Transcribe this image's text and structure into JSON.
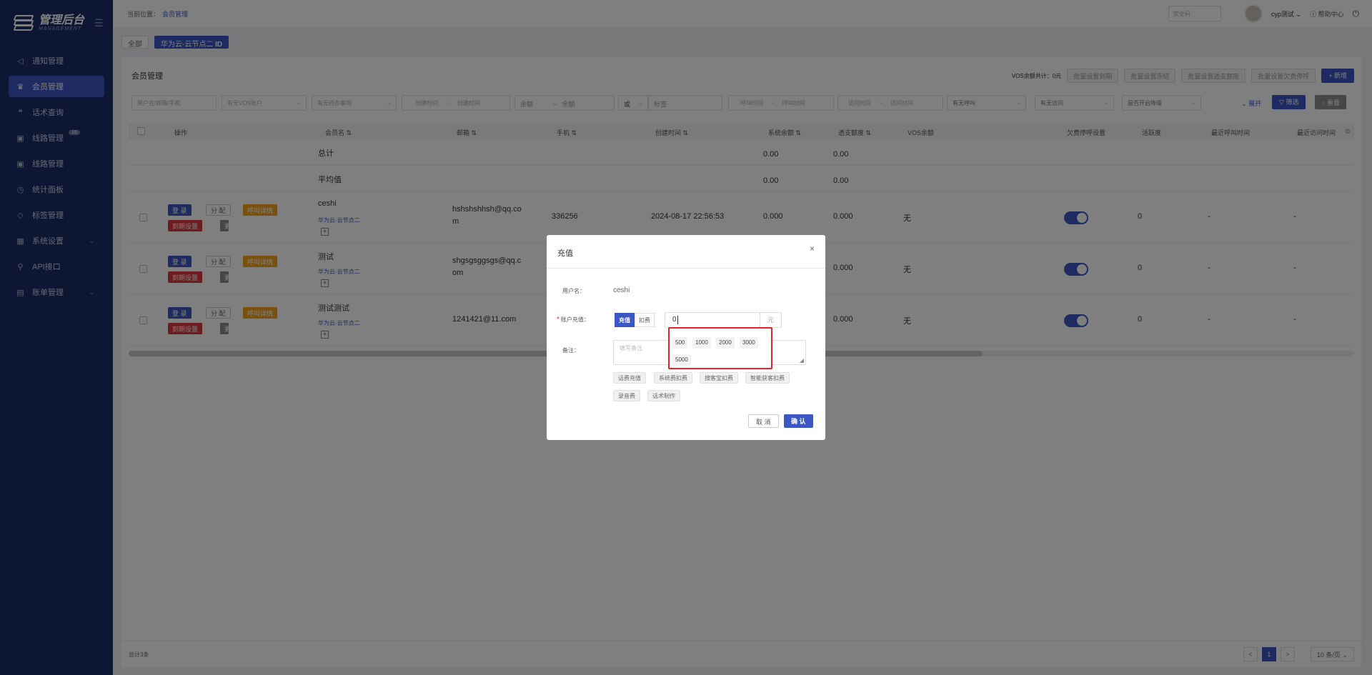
{
  "brand": {
    "title": "管理后台",
    "subtitle": "MANAGEMENT"
  },
  "sidebar": {
    "items": [
      {
        "label": "通知管理"
      },
      {
        "label": "会员管理"
      },
      {
        "label": "话术查询"
      },
      {
        "label": "线路管理",
        "badge": "10"
      },
      {
        "label": "线路管理"
      },
      {
        "label": "统计面板"
      },
      {
        "label": "标签管理"
      },
      {
        "label": "系统设置"
      },
      {
        "label": "API接口"
      },
      {
        "label": "账单管理"
      }
    ]
  },
  "topbar": {
    "crumb_prefix": "当前位置：",
    "crumb_link": "会员管理",
    "search_placeholder": "安全码",
    "user": "cyp测试",
    "help": "帮助中心"
  },
  "tags": {
    "all": "全部",
    "active": "华为云-云节点二",
    "active_suffix": "ID"
  },
  "panel": {
    "title": "会员管理",
    "vos_total": "VOS余额共计：0元",
    "batch_buttons": [
      "批量设置到期",
      "批量设置冻结",
      "批量设置透支额度",
      "批量设置欠费停呼"
    ],
    "add_label": "+ 新增",
    "expand_label": "展开",
    "filter_label": "筛选",
    "reset_label": "重置"
  },
  "filters": {
    "user": "用户名/邮箱/手机",
    "vos": "有无VOS账户",
    "todo": "有无待办事项",
    "create_start": "创建时间",
    "create_end": "创建时间",
    "bal_min": "余额",
    "bal_max": "余额",
    "or": "或",
    "tag": "标签",
    "call_start": "呼叫时间",
    "call_end": "呼叫时间",
    "visit_start": "访问时间",
    "visit_end": "访问时间",
    "has_call": "有无呼叫",
    "has_visit": "有无访问",
    "stop": "是否开启降噪",
    "sep": "~"
  },
  "table": {
    "headers": {
      "op": "操作",
      "name": "会员名 ⇅",
      "email": "邮箱 ⇅",
      "phone": "手机 ⇅",
      "created": "创建时间 ⇅",
      "balance": "系统余额 ⇅",
      "overdraft": "透支额度 ⇅",
      "vos": "VOS余额",
      "stop": "欠费停呼设置",
      "activity": "活跃度",
      "last_call": "最近呼叫时间",
      "last_visit": "最近访问时间"
    },
    "summary": [
      {
        "label": "总计",
        "balance": "0.00",
        "overdraft": "0.00"
      },
      {
        "label": "平均值",
        "balance": "0.00",
        "overdraft": "0.00"
      }
    ],
    "row_buttons": {
      "login": "登 录",
      "assign": "分 配",
      "call": "呼叫详情",
      "expire": "到期设置",
      "more": "更 多"
    },
    "rows": [
      {
        "name": "ceshi",
        "sub": "华为云-云节点二",
        "email_line1": "hshshshhsh@qq.co",
        "email_line2": "m",
        "phone": "336256",
        "created": "2024-08-17 22:56:53",
        "balance": "0.000",
        "overdraft": "0.000",
        "vos": "无",
        "activity": "0",
        "last_call": "-",
        "last_visit": "-"
      },
      {
        "name": "测试",
        "sub": "华为云-云节点二",
        "email_line1": "shgsgsggsgs@qq.c",
        "email_line2": "om",
        "phone": "",
        "created": "",
        "balance": "",
        "overdraft": "0.000",
        "vos": "无",
        "activity": "0",
        "last_call": "-",
        "last_visit": "-"
      },
      {
        "name": "测试测试",
        "sub": "华为云-云节点二",
        "email_line1": "1241421@11.com",
        "email_line2": "",
        "phone": "",
        "created": "",
        "balance": "",
        "overdraft": "0.000",
        "vos": "无",
        "activity": "0",
        "last_call": "-",
        "last_visit": "-"
      }
    ]
  },
  "footer": {
    "total": "总计3条",
    "prev": "<",
    "page": "1",
    "next": ">",
    "page_size": "10 条/页"
  },
  "modal": {
    "title": "充值",
    "close": "×",
    "username_label": "用户名：",
    "username": "ceshi",
    "recharge_label": "账户充值：",
    "required_mark": "*",
    "mode_recharge": "充值",
    "mode_deduct": "扣费",
    "amount": "0",
    "unit": "元",
    "remark_label": "备注：",
    "remark_placeholder": "填写备注",
    "quick_amounts": [
      "500",
      "1000",
      "2000",
      "3000",
      "5000"
    ],
    "remark_tags": [
      "话费充值",
      "系统费扣费",
      "搜客宝扣费",
      "智能获客扣费",
      "录音费",
      "话术制作"
    ],
    "cancel": "取 消",
    "confirm": "确 认"
  }
}
